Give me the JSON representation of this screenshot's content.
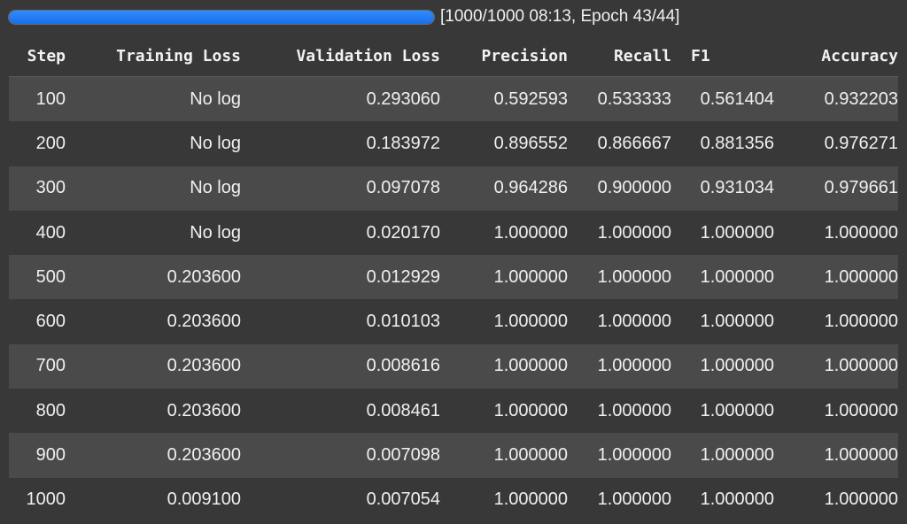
{
  "progress": {
    "fraction": 1.0,
    "text": "[1000/1000 08:13, Epoch 43/44]",
    "color": "#1f77f0"
  },
  "table": {
    "headers": [
      "Step",
      "Training Loss",
      "Validation Loss",
      "Precision",
      "Recall",
      "F1",
      "Accuracy"
    ],
    "rows": [
      [
        "100",
        "No log",
        "0.293060",
        "0.592593",
        "0.533333",
        "0.561404",
        "0.932203"
      ],
      [
        "200",
        "No log",
        "0.183972",
        "0.896552",
        "0.866667",
        "0.881356",
        "0.976271"
      ],
      [
        "300",
        "No log",
        "0.097078",
        "0.964286",
        "0.900000",
        "0.931034",
        "0.979661"
      ],
      [
        "400",
        "No log",
        "0.020170",
        "1.000000",
        "1.000000",
        "1.000000",
        "1.000000"
      ],
      [
        "500",
        "0.203600",
        "0.012929",
        "1.000000",
        "1.000000",
        "1.000000",
        "1.000000"
      ],
      [
        "600",
        "0.203600",
        "0.010103",
        "1.000000",
        "1.000000",
        "1.000000",
        "1.000000"
      ],
      [
        "700",
        "0.203600",
        "0.008616",
        "1.000000",
        "1.000000",
        "1.000000",
        "1.000000"
      ],
      [
        "800",
        "0.203600",
        "0.008461",
        "1.000000",
        "1.000000",
        "1.000000",
        "1.000000"
      ],
      [
        "900",
        "0.203600",
        "0.007098",
        "1.000000",
        "1.000000",
        "1.000000",
        "1.000000"
      ],
      [
        "1000",
        "0.009100",
        "0.007054",
        "1.000000",
        "1.000000",
        "1.000000",
        "1.000000"
      ]
    ]
  }
}
